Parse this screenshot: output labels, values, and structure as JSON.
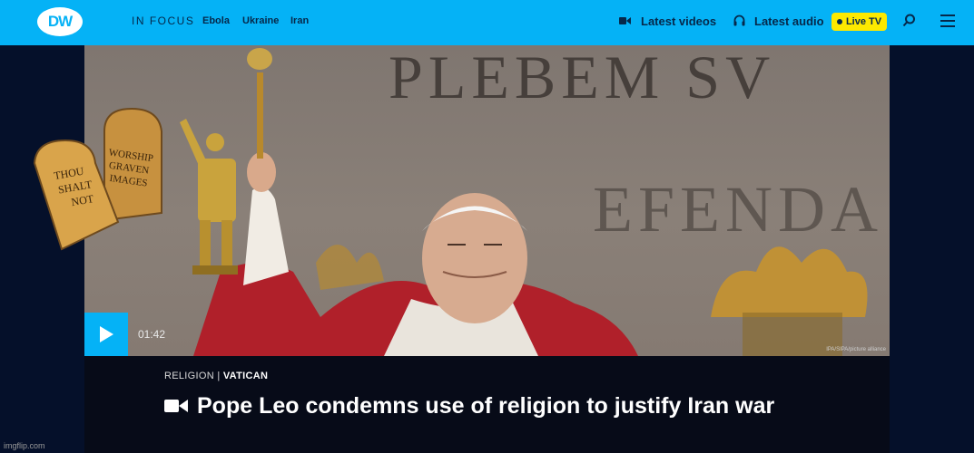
{
  "header": {
    "logo_text": "DW",
    "in_focus_label": "IN FOCUS",
    "focus_links": [
      "Ebola",
      "Ukraine",
      "Iran"
    ],
    "latest_videos": "Latest videos",
    "latest_audio": "Latest audio",
    "live_tv": "Live TV"
  },
  "hero": {
    "carved_line1": "PLEBEM SV",
    "carved_line2": "EFENDA",
    "tablet_left": "THOU SHALT NOT",
    "tablet_right": "WORSHIP GRAVEN IMAGES",
    "credit": "IPA/SIPA/picture alliance"
  },
  "video": {
    "duration": "01:42"
  },
  "article": {
    "category": "RELIGION",
    "separator": " | ",
    "subcategory": "VATICAN",
    "headline": "Pope Leo condemns use of religion to justify Iran war"
  },
  "watermark": "imgflip.com",
  "colors": {
    "brand_blue": "#05b2f6",
    "live_yellow": "#fde900",
    "navy": "#06284a"
  }
}
